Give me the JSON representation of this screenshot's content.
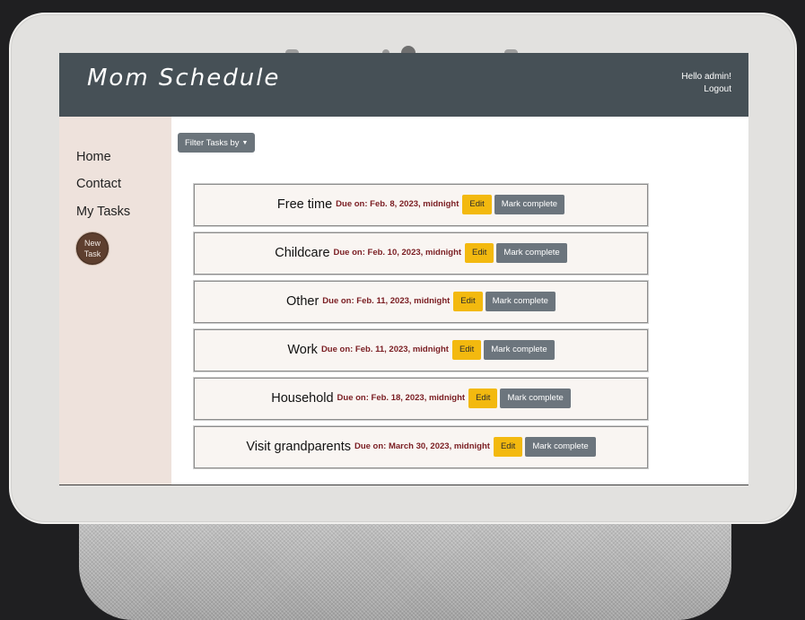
{
  "app": {
    "title": "Mom Schedule",
    "greeting": "Hello admin!",
    "logout_label": "Logout"
  },
  "sidebar": {
    "items": [
      {
        "label": "Home"
      },
      {
        "label": "Contact"
      },
      {
        "label": "My Tasks"
      }
    ],
    "new_task_line1": "New",
    "new_task_line2": "Task"
  },
  "filter": {
    "label": "Filter Tasks by"
  },
  "tasks": [
    {
      "title": "Free time",
      "due": "Due on: Feb. 8, 2023, midnight",
      "edit_label": "Edit",
      "complete_label": "Mark complete"
    },
    {
      "title": "Childcare",
      "due": "Due on: Feb. 10, 2023, midnight",
      "edit_label": "Edit",
      "complete_label": "Mark complete"
    },
    {
      "title": "Other",
      "due": "Due on: Feb. 11, 2023, midnight",
      "edit_label": "Edit",
      "complete_label": "Mark complete"
    },
    {
      "title": "Work",
      "due": "Due on: Feb. 11, 2023, midnight",
      "edit_label": "Edit",
      "complete_label": "Mark complete"
    },
    {
      "title": "Household",
      "due": "Due on: Feb. 18, 2023, midnight",
      "edit_label": "Edit",
      "complete_label": "Mark complete"
    },
    {
      "title": "Visit grandparents",
      "due": "Due on: March 30, 2023, midnight",
      "edit_label": "Edit",
      "complete_label": "Mark complete"
    }
  ],
  "colors": {
    "header_bg": "#465056",
    "sidebar_bg": "#eee2dc",
    "due_text": "#7a1d22",
    "edit_button": "#f3b90f",
    "complete_button": "#6c757d",
    "new_task_button": "#5e3f2f"
  }
}
